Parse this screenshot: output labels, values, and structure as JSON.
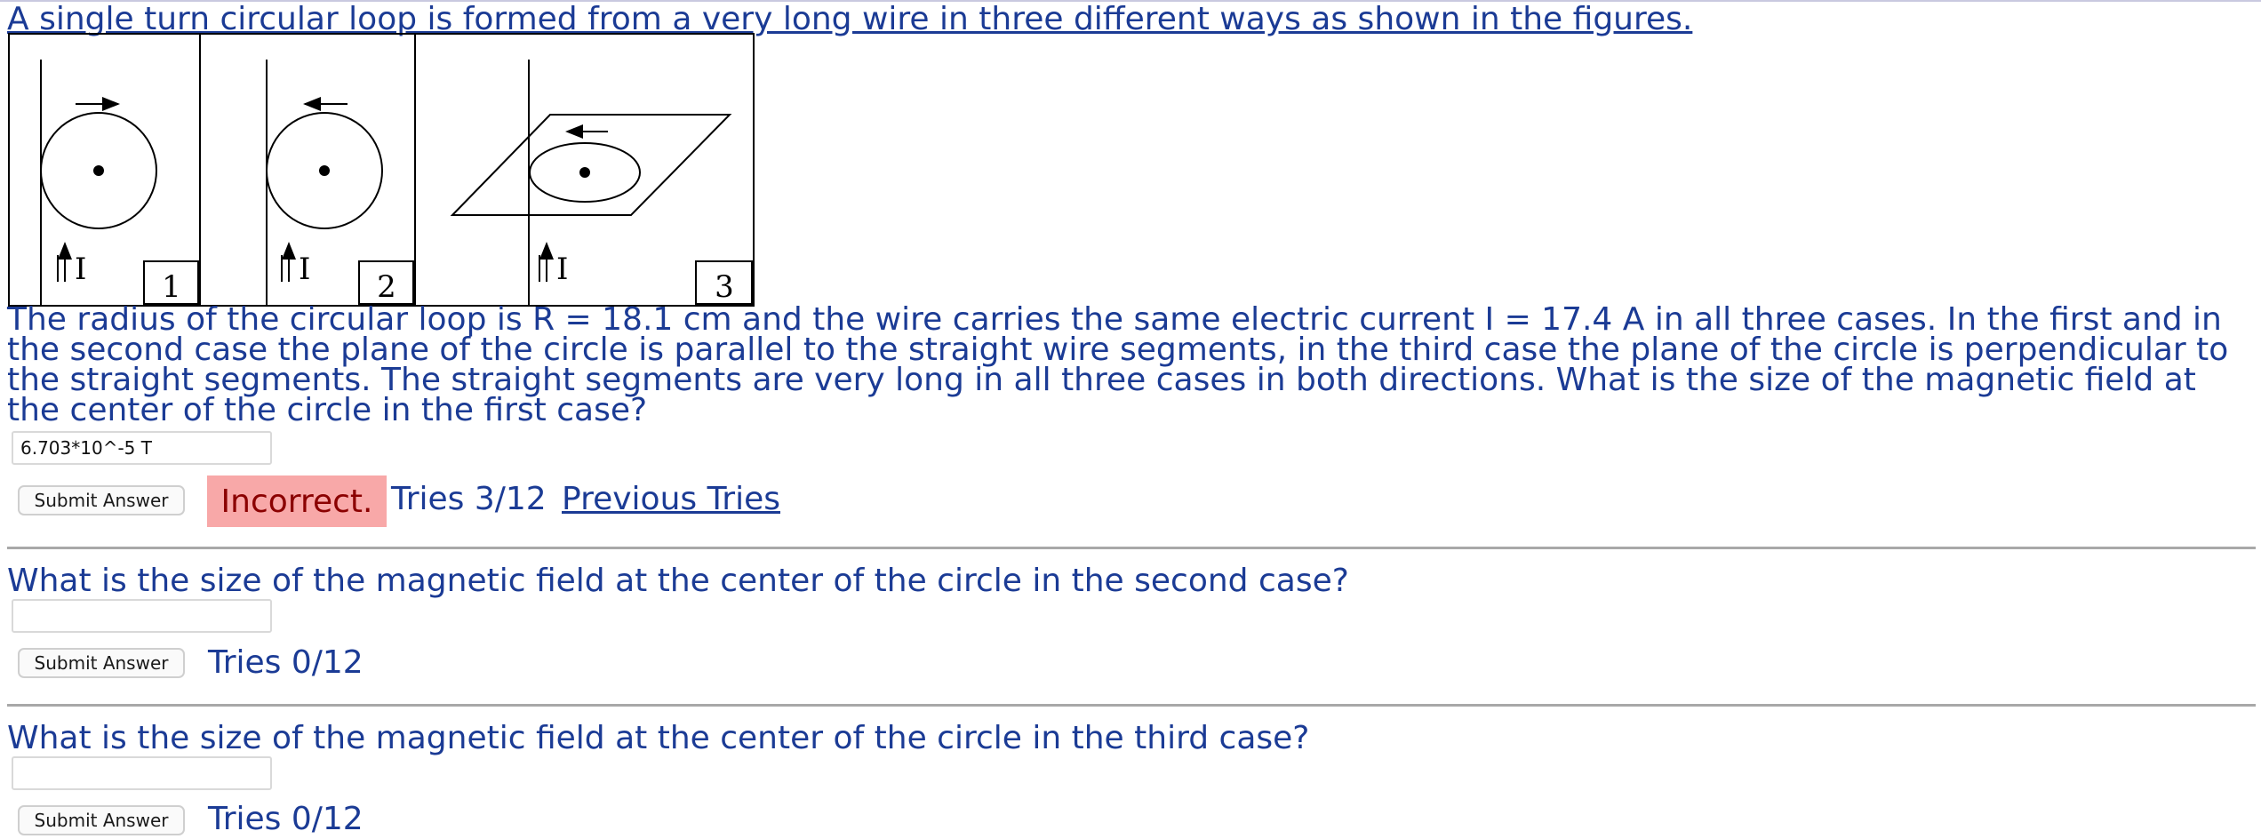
{
  "intro_text": "A single turn circular loop is formed from a very long wire in three different ways as shown in the figures.",
  "figure": {
    "panel_labels": [
      "1",
      "2",
      "3"
    ],
    "current_label": "I"
  },
  "problem_text": "The radius of the circular loop is R = 18.1 cm and the wire carries the same electric current I = 17.4 A in all three cases. In the first and in the second case the plane of the circle is parallel to the straight wire segments, in the third case the plane of the circle is perpendicular to the straight segments. The straight segments are very long in all three cases in both directions. What is the size of the magnetic field at the center of the circle in the first case?",
  "part1": {
    "answer_value": "6.703*10^-5 T",
    "submit_label": "Submit Answer",
    "status": "Incorrect.",
    "tries": "Tries 3/12",
    "previous_tries_label": "Previous Tries"
  },
  "part2": {
    "question": "What is the size of the magnetic field at the center of the circle in the second case?",
    "answer_value": "",
    "submit_label": "Submit Answer",
    "tries": "Tries 0/12"
  },
  "part3": {
    "question": "What is the size of the magnetic field at the center of the circle in the third case?",
    "answer_value": "",
    "submit_label": "Submit Answer",
    "tries": "Tries 0/12"
  },
  "colors": {
    "text_blue": "#1b3b95",
    "incorrect_bg": "#f8a8a8",
    "incorrect_text": "#8b0000"
  }
}
